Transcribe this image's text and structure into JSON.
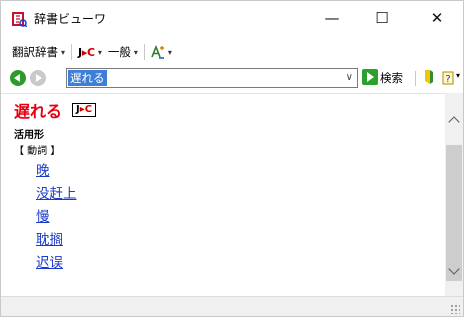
{
  "window": {
    "title": "辞書ビューワ",
    "min_glyph": "—",
    "max_glyph": "☐",
    "close_glyph": "✕"
  },
  "toolbar": {
    "dict_menu_label": "翻訳辞書",
    "jc_label_j": "J",
    "jc_label_arrow": "▸",
    "jc_label_c": "C",
    "field_label": "一般",
    "dropdown_glyph": "▾"
  },
  "search": {
    "value": "遅れる",
    "dropdown_glyph": "∨",
    "go_label": "検索"
  },
  "entry": {
    "headword": "遅れる",
    "badge_j": "J",
    "badge_arrow": "▸",
    "badge_c": "C",
    "section": "活用形",
    "pos": "【 動詞 】",
    "translations": [
      "晚",
      "没赶上",
      "慢",
      "耽搁",
      "迟误"
    ]
  },
  "colors": {
    "headword": "#e60012",
    "link": "#1a3aca",
    "selection": "#3c7ed8",
    "go_button": "#2aa12a",
    "back_button": "#2e9a2e"
  },
  "icons": [
    "app-dictionary-icon",
    "back-arrow-icon",
    "forward-arrow-icon",
    "go-arrow-icon",
    "marker-icon",
    "help-icon",
    "translate-icon"
  ]
}
